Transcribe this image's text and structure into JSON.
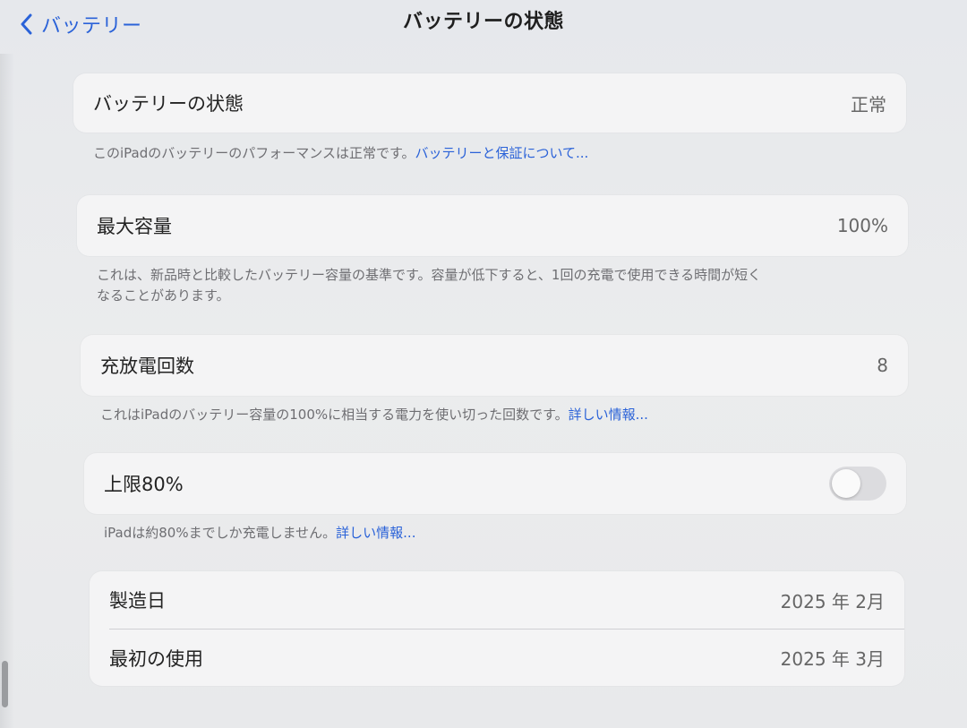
{
  "nav": {
    "back_label": "バッテリー",
    "title": "バッテリーの状態"
  },
  "health": {
    "label": "バッテリーの状態",
    "value": "正常",
    "footer_text": "このiPadのバッテリーのパフォーマンスは正常です。",
    "footer_link": "バッテリーと保証について..."
  },
  "capacity": {
    "label": "最大容量",
    "value": "100%",
    "footer_line1": "これは、新品時と比較したバッテリー容量の基準です。容量が低下すると、1回の充電で使用できる時間が短く",
    "footer_line2": "なることがあります。"
  },
  "cycles": {
    "label": "充放電回数",
    "value": "8",
    "footer_text": "これはiPadのバッテリー容量の100%に相当する電力を使い切った回数です。",
    "footer_link": "詳しい情報..."
  },
  "limit": {
    "label": "上限80%",
    "enabled": false,
    "footer_text": "iPadは約80%までしか充電しません。",
    "footer_link": "詳しい情報..."
  },
  "dates": {
    "manufactured_label": "製造日",
    "manufactured_value": "2025 年 2月",
    "first_use_label": "最初の使用",
    "first_use_value": "2025 年 3月"
  }
}
